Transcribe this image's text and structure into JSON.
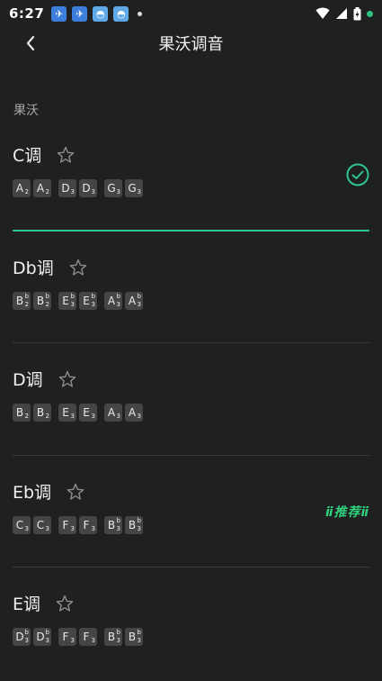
{
  "status_bar": {
    "time": "6:27"
  },
  "header": {
    "title": "果沃调音"
  },
  "section": {
    "label": "果沃"
  },
  "tunes": [
    {
      "name": "C调",
      "selected": true,
      "badge": "",
      "notes": [
        {
          "n": "A",
          "acc": "",
          "oct": "2"
        },
        {
          "n": "A",
          "acc": "",
          "oct": "2"
        },
        {
          "n": "D",
          "acc": "",
          "oct": "3"
        },
        {
          "n": "D",
          "acc": "",
          "oct": "3"
        },
        {
          "n": "G",
          "acc": "",
          "oct": "3"
        },
        {
          "n": "G",
          "acc": "",
          "oct": "3"
        }
      ]
    },
    {
      "name": "Db调",
      "selected": false,
      "badge": "",
      "notes": [
        {
          "n": "B",
          "acc": "b",
          "oct": "2"
        },
        {
          "n": "B",
          "acc": "b",
          "oct": "2"
        },
        {
          "n": "E",
          "acc": "b",
          "oct": "3"
        },
        {
          "n": "E",
          "acc": "b",
          "oct": "3"
        },
        {
          "n": "A",
          "acc": "b",
          "oct": "3"
        },
        {
          "n": "A",
          "acc": "b",
          "oct": "3"
        }
      ]
    },
    {
      "name": "D调",
      "selected": false,
      "badge": "",
      "notes": [
        {
          "n": "B",
          "acc": "",
          "oct": "2"
        },
        {
          "n": "B",
          "acc": "",
          "oct": "2"
        },
        {
          "n": "E",
          "acc": "",
          "oct": "3"
        },
        {
          "n": "E",
          "acc": "",
          "oct": "3"
        },
        {
          "n": "A",
          "acc": "",
          "oct": "3"
        },
        {
          "n": "A",
          "acc": "",
          "oct": "3"
        }
      ]
    },
    {
      "name": "Eb调",
      "selected": false,
      "badge": "推荐",
      "notes": [
        {
          "n": "C",
          "acc": "",
          "oct": "3"
        },
        {
          "n": "C",
          "acc": "",
          "oct": "3"
        },
        {
          "n": "F",
          "acc": "",
          "oct": "3"
        },
        {
          "n": "F",
          "acc": "",
          "oct": "3"
        },
        {
          "n": "B",
          "acc": "b",
          "oct": "3"
        },
        {
          "n": "B",
          "acc": "b",
          "oct": "3"
        }
      ]
    },
    {
      "name": "E调",
      "selected": false,
      "badge": "",
      "notes": [
        {
          "n": "D",
          "acc": "b",
          "oct": "3"
        },
        {
          "n": "D",
          "acc": "b",
          "oct": "3"
        },
        {
          "n": "F",
          "acc": "",
          "oct": "3"
        },
        {
          "n": "F",
          "acc": "",
          "oct": "3"
        },
        {
          "n": "B",
          "acc": "b",
          "oct": "3"
        },
        {
          "n": "B",
          "acc": "b",
          "oct": "3"
        }
      ]
    }
  ],
  "colors": {
    "accent": "#2fc491",
    "recommend": "#2fd07a",
    "background": "#1f2021"
  }
}
